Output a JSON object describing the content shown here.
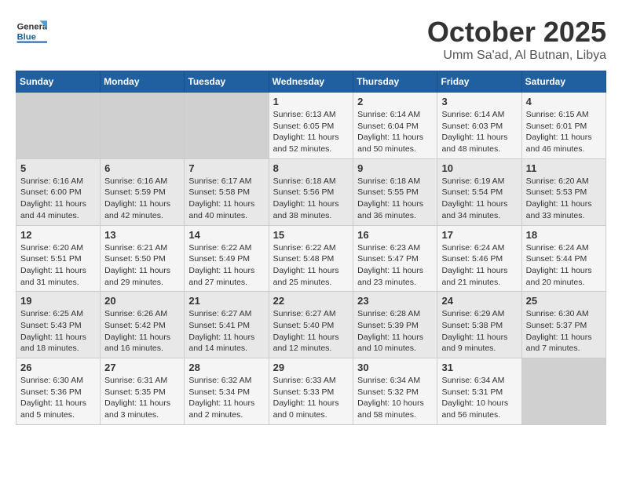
{
  "logo": {
    "general": "General",
    "blue": "Blue"
  },
  "title": "October 2025",
  "subtitle": "Umm Sa'ad, Al Butnan, Libya",
  "days_header": [
    "Sunday",
    "Monday",
    "Tuesday",
    "Wednesday",
    "Thursday",
    "Friday",
    "Saturday"
  ],
  "weeks": [
    [
      {
        "num": "",
        "info": ""
      },
      {
        "num": "",
        "info": ""
      },
      {
        "num": "",
        "info": ""
      },
      {
        "num": "1",
        "info": "Sunrise: 6:13 AM\nSunset: 6:05 PM\nDaylight: 11 hours\nand 52 minutes."
      },
      {
        "num": "2",
        "info": "Sunrise: 6:14 AM\nSunset: 6:04 PM\nDaylight: 11 hours\nand 50 minutes."
      },
      {
        "num": "3",
        "info": "Sunrise: 6:14 AM\nSunset: 6:03 PM\nDaylight: 11 hours\nand 48 minutes."
      },
      {
        "num": "4",
        "info": "Sunrise: 6:15 AM\nSunset: 6:01 PM\nDaylight: 11 hours\nand 46 minutes."
      }
    ],
    [
      {
        "num": "5",
        "info": "Sunrise: 6:16 AM\nSunset: 6:00 PM\nDaylight: 11 hours\nand 44 minutes."
      },
      {
        "num": "6",
        "info": "Sunrise: 6:16 AM\nSunset: 5:59 PM\nDaylight: 11 hours\nand 42 minutes."
      },
      {
        "num": "7",
        "info": "Sunrise: 6:17 AM\nSunset: 5:58 PM\nDaylight: 11 hours\nand 40 minutes."
      },
      {
        "num": "8",
        "info": "Sunrise: 6:18 AM\nSunset: 5:56 PM\nDaylight: 11 hours\nand 38 minutes."
      },
      {
        "num": "9",
        "info": "Sunrise: 6:18 AM\nSunset: 5:55 PM\nDaylight: 11 hours\nand 36 minutes."
      },
      {
        "num": "10",
        "info": "Sunrise: 6:19 AM\nSunset: 5:54 PM\nDaylight: 11 hours\nand 34 minutes."
      },
      {
        "num": "11",
        "info": "Sunrise: 6:20 AM\nSunset: 5:53 PM\nDaylight: 11 hours\nand 33 minutes."
      }
    ],
    [
      {
        "num": "12",
        "info": "Sunrise: 6:20 AM\nSunset: 5:51 PM\nDaylight: 11 hours\nand 31 minutes."
      },
      {
        "num": "13",
        "info": "Sunrise: 6:21 AM\nSunset: 5:50 PM\nDaylight: 11 hours\nand 29 minutes."
      },
      {
        "num": "14",
        "info": "Sunrise: 6:22 AM\nSunset: 5:49 PM\nDaylight: 11 hours\nand 27 minutes."
      },
      {
        "num": "15",
        "info": "Sunrise: 6:22 AM\nSunset: 5:48 PM\nDaylight: 11 hours\nand 25 minutes."
      },
      {
        "num": "16",
        "info": "Sunrise: 6:23 AM\nSunset: 5:47 PM\nDaylight: 11 hours\nand 23 minutes."
      },
      {
        "num": "17",
        "info": "Sunrise: 6:24 AM\nSunset: 5:46 PM\nDaylight: 11 hours\nand 21 minutes."
      },
      {
        "num": "18",
        "info": "Sunrise: 6:24 AM\nSunset: 5:44 PM\nDaylight: 11 hours\nand 20 minutes."
      }
    ],
    [
      {
        "num": "19",
        "info": "Sunrise: 6:25 AM\nSunset: 5:43 PM\nDaylight: 11 hours\nand 18 minutes."
      },
      {
        "num": "20",
        "info": "Sunrise: 6:26 AM\nSunset: 5:42 PM\nDaylight: 11 hours\nand 16 minutes."
      },
      {
        "num": "21",
        "info": "Sunrise: 6:27 AM\nSunset: 5:41 PM\nDaylight: 11 hours\nand 14 minutes."
      },
      {
        "num": "22",
        "info": "Sunrise: 6:27 AM\nSunset: 5:40 PM\nDaylight: 11 hours\nand 12 minutes."
      },
      {
        "num": "23",
        "info": "Sunrise: 6:28 AM\nSunset: 5:39 PM\nDaylight: 11 hours\nand 10 minutes."
      },
      {
        "num": "24",
        "info": "Sunrise: 6:29 AM\nSunset: 5:38 PM\nDaylight: 11 hours\nand 9 minutes."
      },
      {
        "num": "25",
        "info": "Sunrise: 6:30 AM\nSunset: 5:37 PM\nDaylight: 11 hours\nand 7 minutes."
      }
    ],
    [
      {
        "num": "26",
        "info": "Sunrise: 6:30 AM\nSunset: 5:36 PM\nDaylight: 11 hours\nand 5 minutes."
      },
      {
        "num": "27",
        "info": "Sunrise: 6:31 AM\nSunset: 5:35 PM\nDaylight: 11 hours\nand 3 minutes."
      },
      {
        "num": "28",
        "info": "Sunrise: 6:32 AM\nSunset: 5:34 PM\nDaylight: 11 hours\nand 2 minutes."
      },
      {
        "num": "29",
        "info": "Sunrise: 6:33 AM\nSunset: 5:33 PM\nDaylight: 11 hours\nand 0 minutes."
      },
      {
        "num": "30",
        "info": "Sunrise: 6:34 AM\nSunset: 5:32 PM\nDaylight: 10 hours\nand 58 minutes."
      },
      {
        "num": "31",
        "info": "Sunrise: 6:34 AM\nSunset: 5:31 PM\nDaylight: 10 hours\nand 56 minutes."
      },
      {
        "num": "",
        "info": ""
      }
    ]
  ]
}
